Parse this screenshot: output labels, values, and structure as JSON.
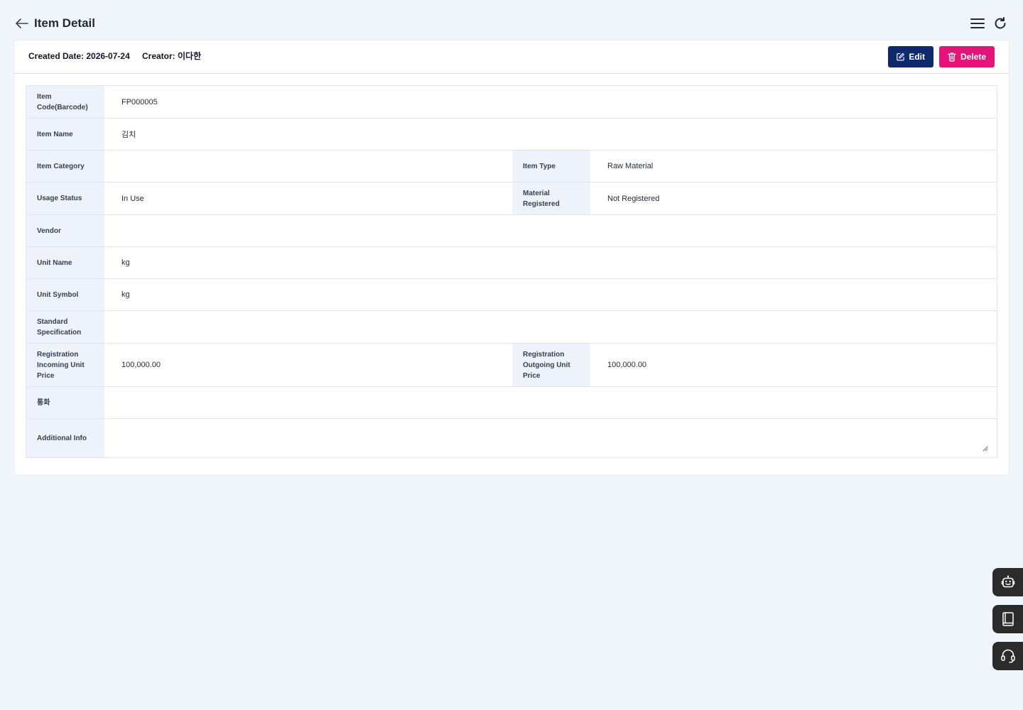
{
  "header": {
    "title": "Item Detail"
  },
  "meta": {
    "created": "Created Date: 2026-07-24",
    "creator": "Creator: 이다한"
  },
  "actions": {
    "edit_label": "Edit",
    "delete_label": "Delete"
  },
  "fields": {
    "item_code": {
      "label": "Item Code(Barcode)",
      "value": "FP000005"
    },
    "item_name": {
      "label": "Item Name",
      "value": "김치"
    },
    "item_category": {
      "label": "Item Category",
      "value": ""
    },
    "item_type": {
      "label": "Item Type",
      "value": "Raw Material"
    },
    "usage_status": {
      "label": "Usage Status",
      "value": "In Use"
    },
    "material_registered": {
      "label": "Material Registered",
      "value": "Not Registered"
    },
    "vendor": {
      "label": "Vendor",
      "value": ""
    },
    "unit_name": {
      "label": "Unit Name",
      "value": "kg"
    },
    "unit_symbol": {
      "label": "Unit Symbol",
      "value": "kg"
    },
    "standard_spec": {
      "label": "Standard Specification",
      "value": ""
    },
    "incoming_price": {
      "label": "Registration Incoming Unit Price",
      "value": "100,000.00"
    },
    "outgoing_price": {
      "label": "Registration Outgoing Unit Price",
      "value": "100,000.00"
    },
    "currency": {
      "label": "통화",
      "value": ""
    },
    "additional_info": {
      "label": "Additional Info",
      "value": ""
    }
  },
  "colors": {
    "primary": "#0f2a6b",
    "danger": "#e3157a",
    "background": "#f1f5fc",
    "label_bg": "#edf2fb"
  },
  "icons": {
    "back": "arrow-left-icon",
    "menu": "hamburger-menu-icon",
    "refresh": "refresh-icon",
    "edit": "edit-icon",
    "delete": "trash-icon",
    "chatbot": "robot-icon",
    "manual": "book-icon",
    "support": "headset-icon"
  }
}
